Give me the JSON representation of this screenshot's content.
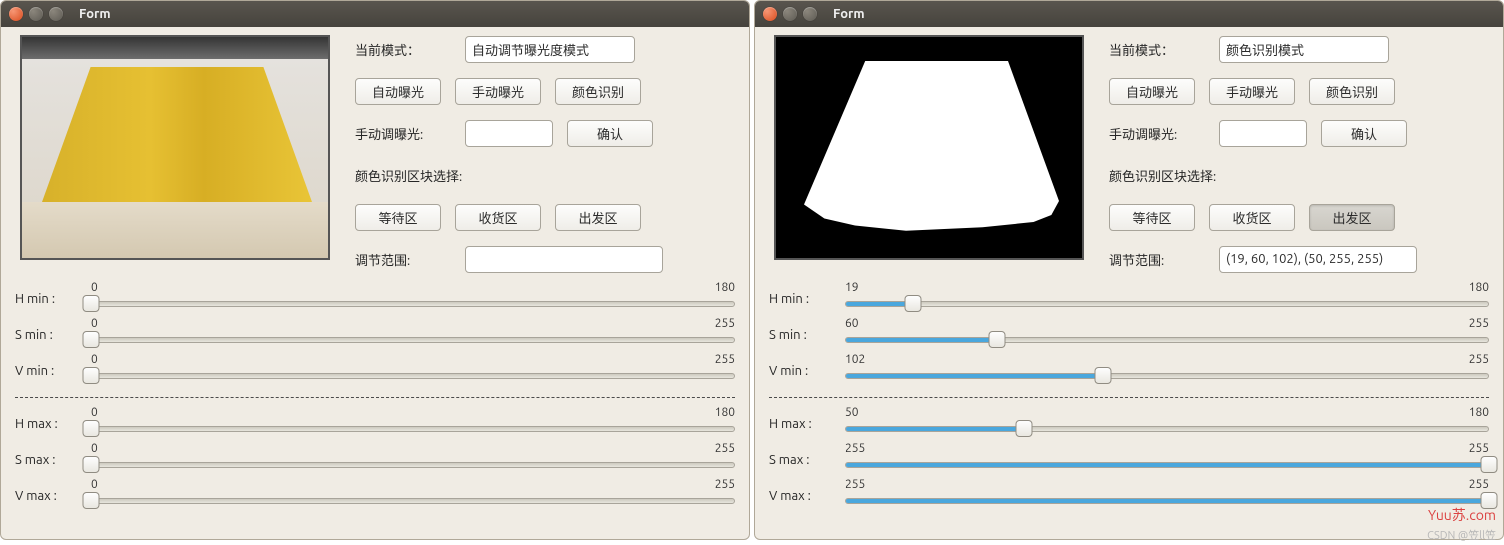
{
  "windows": [
    {
      "title": "Form",
      "preview_kind": "camera",
      "mode_label": "当前模式：",
      "mode_value": "自动调节曝光度模式",
      "buttons": {
        "auto_expo": "自动曝光",
        "manual_expo": "手动曝光",
        "color_rec": "颜色识别",
        "confirm": "确认",
        "waiting": "等待区",
        "receiving": "收货区",
        "departure": "出发区"
      },
      "active_button": "",
      "manual_label": "手动调曝光:",
      "manual_value": "",
      "area_label": "颜色识别区块选择:",
      "range_label": "调节范围:",
      "range_value": "",
      "sliders_min": [
        {
          "label": "H  min :",
          "val": 0,
          "min": 0,
          "max": 180,
          "fill": false
        },
        {
          "label": "S  min :",
          "val": 0,
          "min": 0,
          "max": 255,
          "fill": false
        },
        {
          "label": "V  min :",
          "val": 0,
          "min": 0,
          "max": 255,
          "fill": false
        }
      ],
      "sliders_max": [
        {
          "label": "H  max :",
          "val": 0,
          "min": 0,
          "max": 180,
          "fill": false
        },
        {
          "label": "S  max :",
          "val": 0,
          "min": 0,
          "max": 255,
          "fill": false
        },
        {
          "label": "V  max :",
          "val": 0,
          "min": 0,
          "max": 255,
          "fill": false
        }
      ]
    },
    {
      "title": "Form",
      "preview_kind": "mask",
      "mode_label": "当前模式：",
      "mode_value": "颜色识别模式",
      "buttons": {
        "auto_expo": "自动曝光",
        "manual_expo": "手动曝光",
        "color_rec": "颜色识别",
        "confirm": "确认",
        "waiting": "等待区",
        "receiving": "收货区",
        "departure": "出发区"
      },
      "active_button": "departure",
      "manual_label": "手动调曝光:",
      "manual_value": "",
      "area_label": "颜色识别区块选择:",
      "range_label": "调节范围:",
      "range_value": "(19, 60, 102), (50, 255, 255)",
      "sliders_min": [
        {
          "label": "H  min :",
          "val": 19,
          "min": 0,
          "max": 180,
          "fill": true
        },
        {
          "label": "S  min :",
          "val": 60,
          "min": 0,
          "max": 255,
          "fill": true
        },
        {
          "label": "V  min :",
          "val": 102,
          "min": 0,
          "max": 255,
          "fill": true
        }
      ],
      "sliders_max": [
        {
          "label": "H  max :",
          "val": 50,
          "min": 0,
          "max": 180,
          "fill": true
        },
        {
          "label": "S  max :",
          "val": 255,
          "min": 0,
          "max": 255,
          "fill": true
        },
        {
          "label": "V  max :",
          "val": 255,
          "min": 0,
          "max": 255,
          "fill": true
        }
      ]
    }
  ],
  "watermark": "Yuu苏.com",
  "csdn": "CSDN @笠ll笠"
}
